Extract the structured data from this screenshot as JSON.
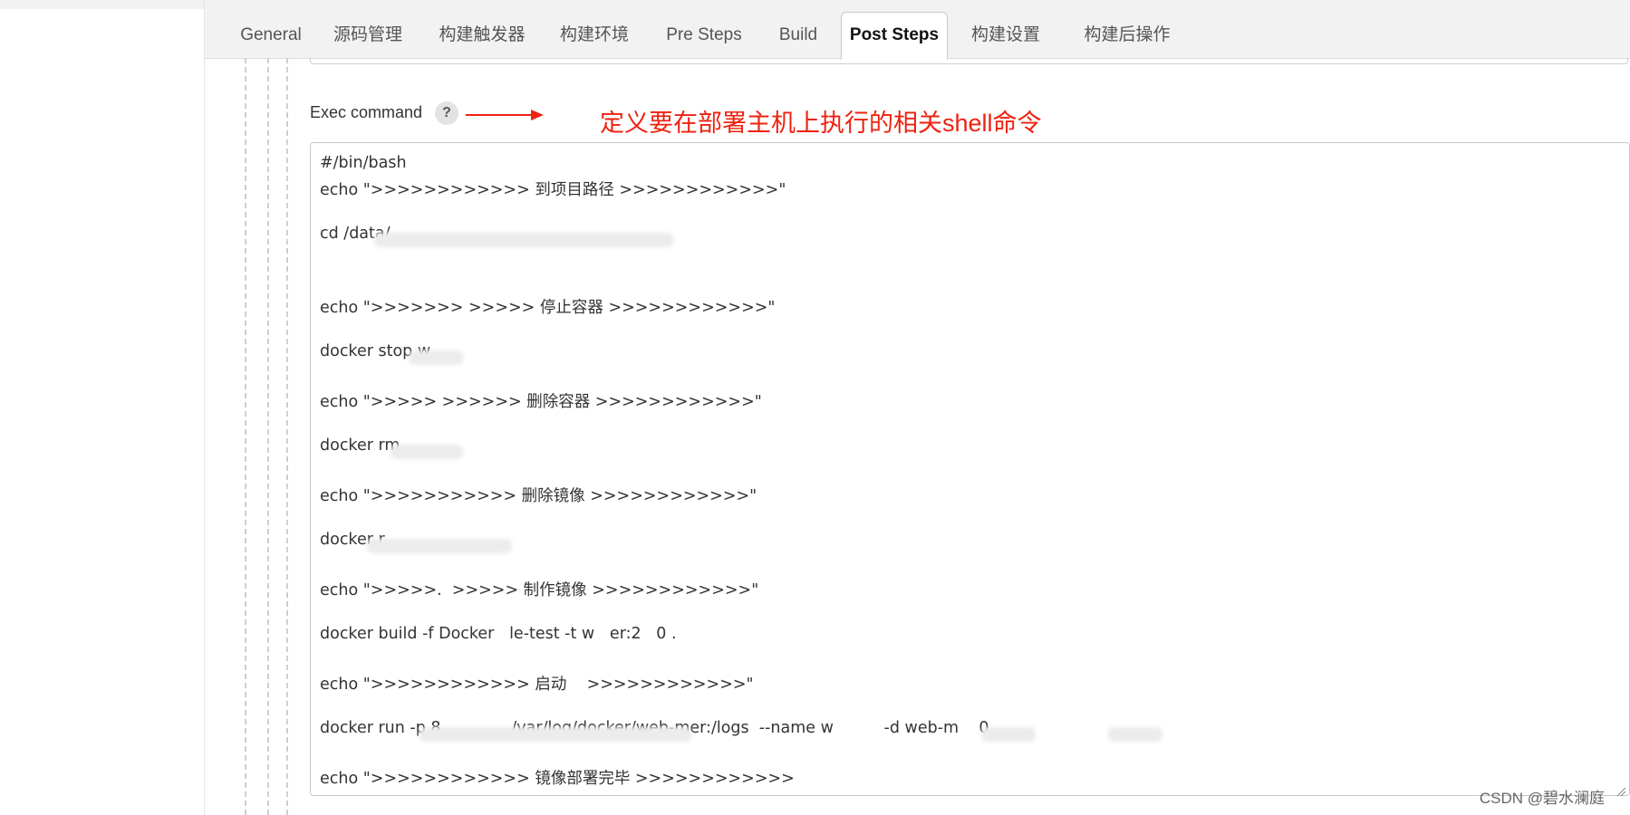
{
  "tabs": [
    {
      "label": "General",
      "active": false
    },
    {
      "label": "源码管理",
      "active": false
    },
    {
      "label": "构建触发器",
      "active": false
    },
    {
      "label": "构建环境",
      "active": false
    },
    {
      "label": "Pre Steps",
      "active": false
    },
    {
      "label": "Build",
      "active": false
    },
    {
      "label": "Post Steps",
      "active": true
    },
    {
      "label": "构建设置",
      "active": false
    },
    {
      "label": "构建后操作",
      "active": false
    }
  ],
  "exec": {
    "label": "Exec command",
    "help": "?",
    "annotation": "定义要在部署主机上执行的相关shell命令",
    "annotation_color": "#ee2211"
  },
  "script_lines": [
    "#/bin/bash",
    "echo \">>>>>>>>>>>> 到项目路径 >>>>>>>>>>>>\"",
    "cd /data/",
    "echo \">>>>>>> >>>>> 停止容器 >>>>>>>>>>>>\"",
    "docker stop w",
    "echo \">>>>> >>>>>> 删除容器 >>>>>>>>>>>>\"",
    "docker rm",
    "echo \">>>>>>>>>>> 删除镜像 >>>>>>>>>>>>\"",
    "docker r",
    "echo \">>>>>.  >>>>> 制作镜像 >>>>>>>>>>>>\"",
    "docker build -f Docker   le-test -t w   er:2   0 .",
    "echo \">>>>>>>>>>>> 启动    >>>>>>>>>>>>\"",
    "docker run -p 8              /var/log/docker/web-mer:/logs  --name w          -d web-m    0",
    "echo \">>>>>>>>>>>> 镜像部署完毕 >>>>>>>>>>>>"
  ],
  "watermark": "CSDN @碧水澜庭"
}
